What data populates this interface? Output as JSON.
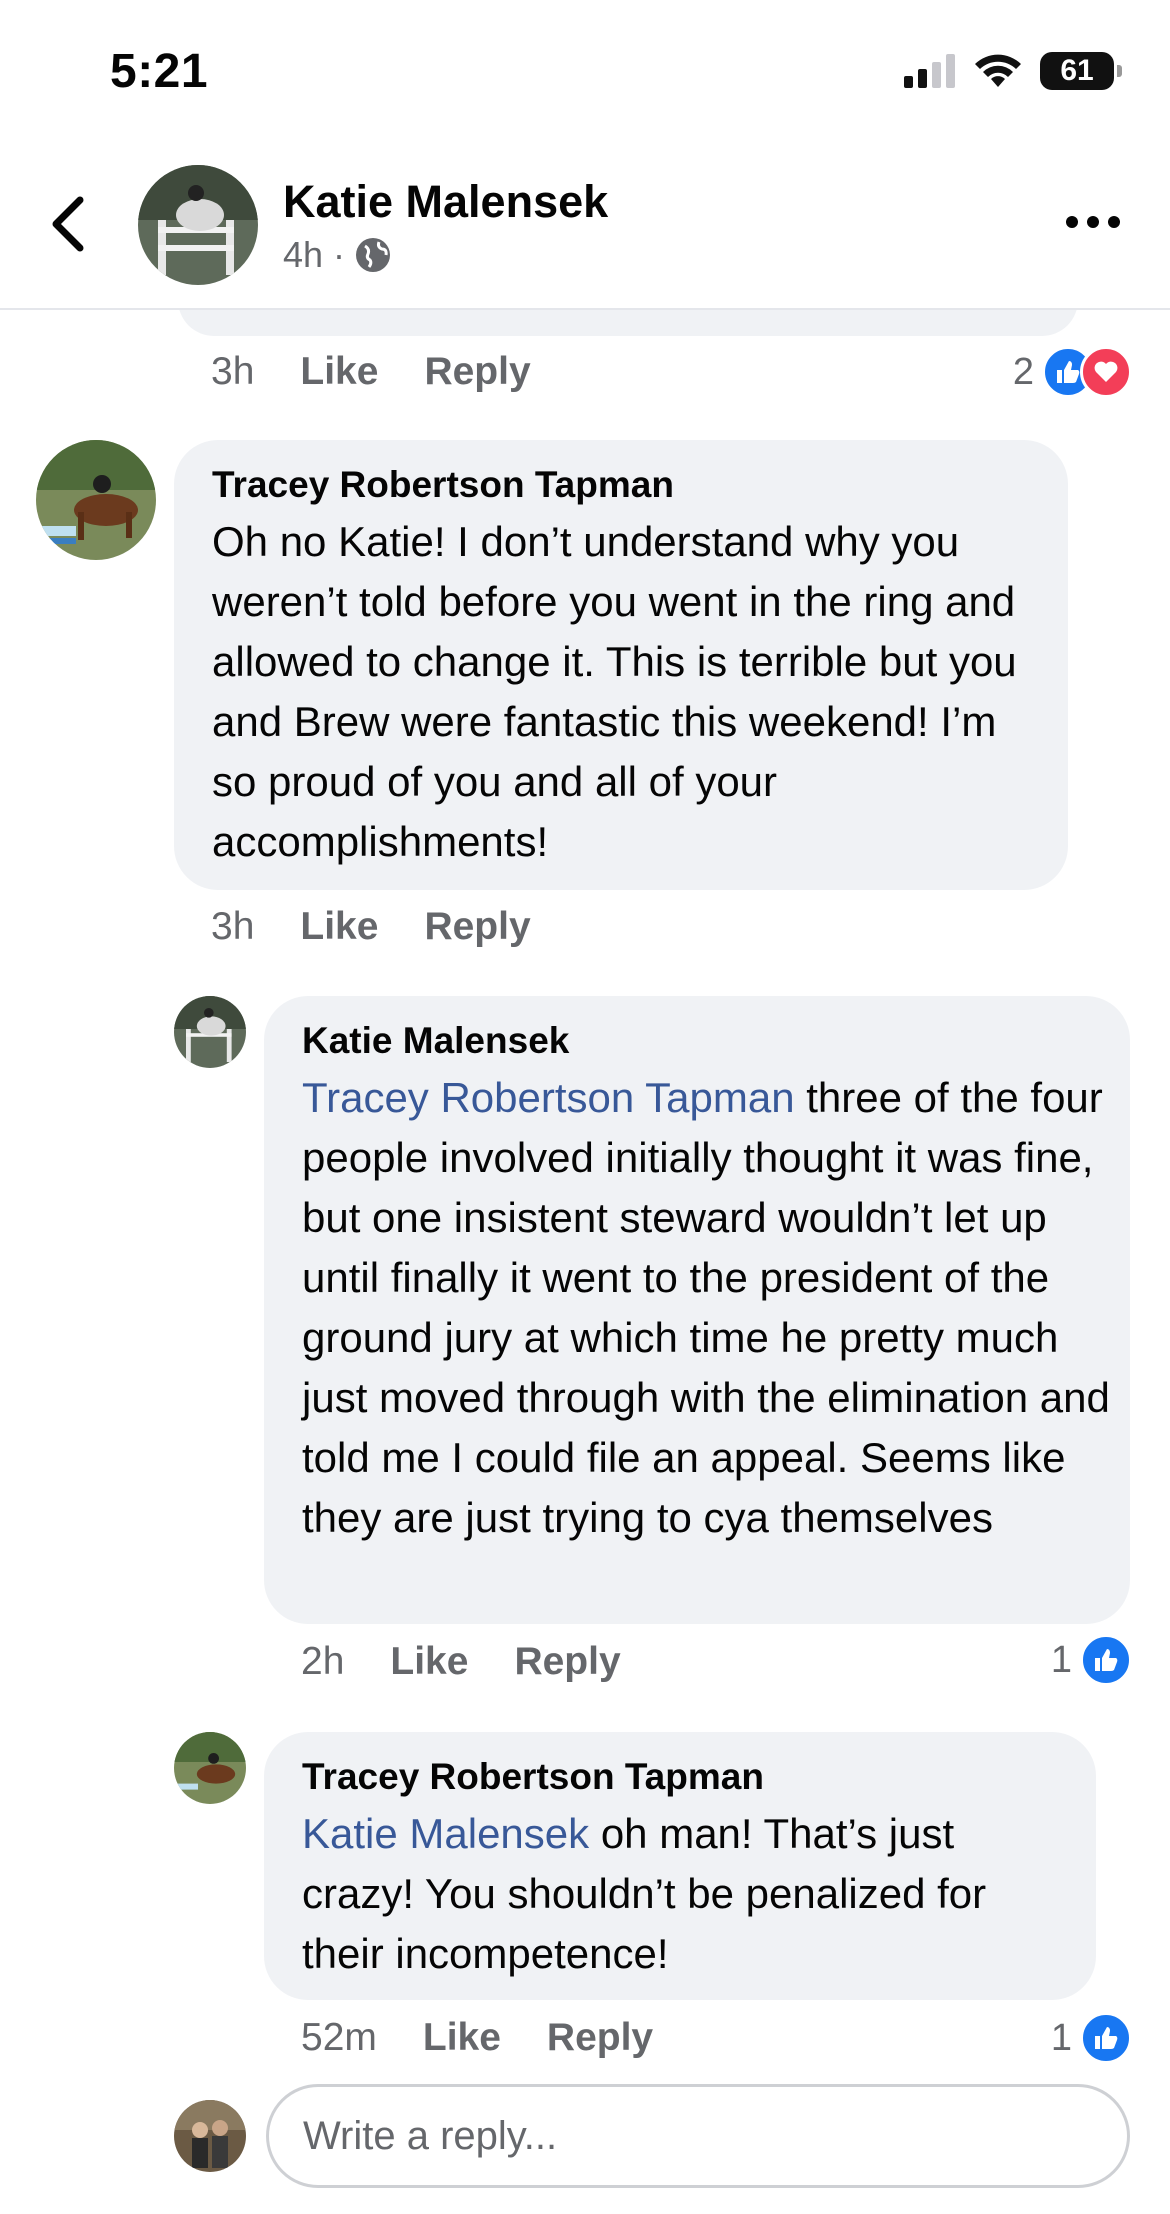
{
  "status_bar": {
    "time": "5:21",
    "battery": "61"
  },
  "header": {
    "name": "Katie Malensek",
    "time": "4h",
    "separator": "·"
  },
  "actions_labels": {
    "like": "Like",
    "reply": "Reply"
  },
  "top_comment": {
    "time": "3h",
    "reaction_count": "2"
  },
  "comments": [
    {
      "author": "Tracey Robertson Tapman",
      "mention": "",
      "text": "Oh no Katie! I don’t understand why you weren’t told before you went in the ring and allowed to change it. This is terrible but you and Brew were fantastic this weekend! I’m so proud of you and all of your accomplishments!",
      "time": "3h",
      "reaction_count": ""
    },
    {
      "author": "Katie Malensek",
      "mention": "Tracey Robertson Tapman",
      "text": " three of the four people involved initially thought it was fine, but one insistent steward wouldn’t let up until finally it went to the president of the ground jury at which time he pretty  much just moved through with the elimination and told me I could file an appeal. Seems like they are just trying to cya themselves",
      "time": "2h",
      "reaction_count": "1"
    },
    {
      "author": "Tracey Robertson Tapman",
      "mention": "Katie Malensek",
      "text": " oh man! That’s just crazy! You shouldn’t be penalized for their incompetence!",
      "time": "52m",
      "reaction_count": "1"
    }
  ],
  "reply_box": {
    "placeholder": "Write a reply..."
  },
  "colors": {
    "mention": "#385898",
    "like": "#1877f2",
    "love": "#f33e58",
    "bubble": "#f0f2f5"
  }
}
